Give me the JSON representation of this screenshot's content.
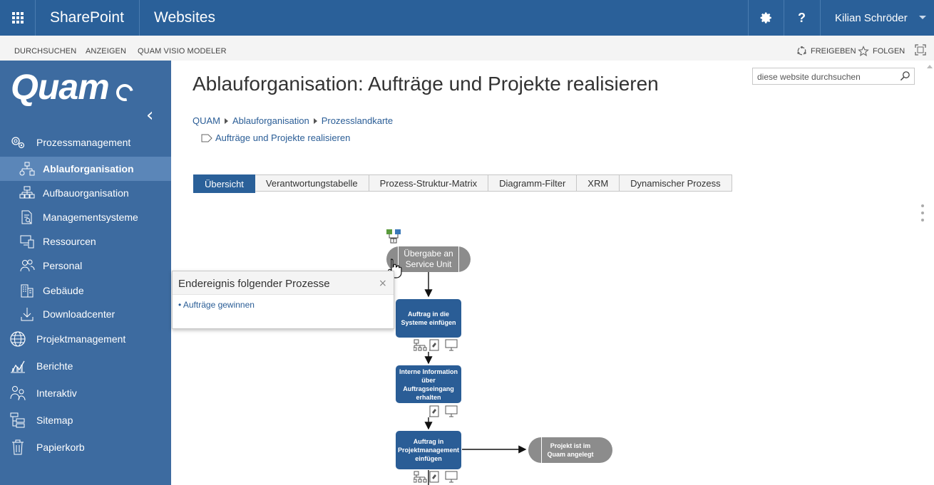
{
  "suitebar": {
    "brand": "SharePoint",
    "site_title": "Websites",
    "help_label": "?",
    "user_name": "Kilian Schröder"
  },
  "ribbon": {
    "items": [
      "DURCHSUCHEN",
      "ANZEIGEN",
      "QUAM VISIO MODELER"
    ],
    "share_label": "FREIGEBEN",
    "follow_label": "FOLGEN"
  },
  "leftnav": {
    "logo_text": "Quam",
    "items": [
      {
        "label": "Prozessmanagement",
        "icon": "gears-icon",
        "level": "top"
      },
      {
        "label": "Ablauforganisation",
        "icon": "flow-icon",
        "level": "sub",
        "active": true
      },
      {
        "label": "Aufbauorganisation",
        "icon": "org-chart-icon",
        "level": "sub"
      },
      {
        "label": "Managementsysteme",
        "icon": "document-search-icon",
        "level": "sub"
      },
      {
        "label": "Ressourcen",
        "icon": "devices-icon",
        "level": "sub"
      },
      {
        "label": "Personal",
        "icon": "people-icon",
        "level": "sub"
      },
      {
        "label": "Gebäude",
        "icon": "building-icon",
        "level": "sub"
      },
      {
        "label": "Downloadcenter",
        "icon": "download-icon",
        "level": "sub"
      },
      {
        "label": "Projektmanagement",
        "icon": "globe-icon",
        "level": "top"
      },
      {
        "label": "Berichte",
        "icon": "chart-icon",
        "level": "top"
      },
      {
        "label": "Interaktiv",
        "icon": "users-icon",
        "level": "top"
      },
      {
        "label": "Sitemap",
        "icon": "sitemap-icon",
        "level": "top"
      },
      {
        "label": "Papierkorb",
        "icon": "trash-icon",
        "level": "top"
      }
    ]
  },
  "search": {
    "placeholder": "diese website durchsuchen"
  },
  "page": {
    "title": "Ablauforganisation: Aufträge und Projekte realisieren",
    "breadcrumb": [
      "QUAM",
      "Ablauforganisation",
      "Prozesslandkarte"
    ],
    "current": "Aufträge und Projekte realisieren"
  },
  "tabs": [
    "Übersicht",
    "Verantwortungstabelle",
    "Prozess-Struktur-Matrix",
    "Diagramm-Filter",
    "XRM",
    "Dynamischer Prozess"
  ],
  "diagram": {
    "start_event": "Übergabe an Service Unit",
    "steps": [
      "Auftrag in die Systeme einfügen",
      "Interne Information über Auftragseingang erhalten",
      "Auftrag in Projektmanagement einfügen"
    ],
    "end_event": "Projekt ist im Quam angelegt"
  },
  "popup": {
    "title": "Endereignis folgender Prozesse",
    "close": "×",
    "items": [
      "Aufträge gewinnen"
    ]
  }
}
